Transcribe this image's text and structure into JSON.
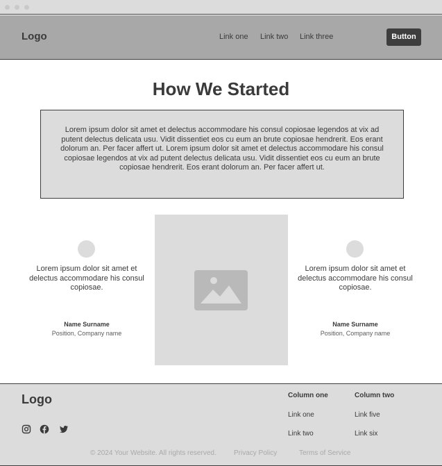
{
  "header": {
    "logo": "Logo",
    "nav": [
      "Link one",
      "Link two",
      "Link three"
    ],
    "button": "Button"
  },
  "hero": {
    "title": "How We Started",
    "body": "Lorem ipsum dolor sit amet et delectus accommodare his consul copiosae legendos at vix ad putent delectus delicata usu. Vidit dissentiet eos cu eum an brute copiosae hendrerit. Eos erant dolorum an. Per facer affert ut. Lorem ipsum dolor sit amet et delectus accommodare his consul copiosae legendos at vix ad putent delectus delicata usu. Vidit dissentiet eos cu eum an brute copiosae hendrerit. Eos erant dolorum an. Per facer affert ut."
  },
  "testimonials": [
    {
      "quote": "Lorem ipsum dolor sit amet et delectus accommodare his consul copiosae.",
      "name": "Name Surname",
      "position": "Position, Company name"
    },
    {
      "quote": "Lorem ipsum dolor sit amet et delectus accommodare his consul copiosae.",
      "name": "Name Surname",
      "position": "Position, Company name"
    }
  ],
  "media": {
    "icon": "image-placeholder-icon"
  },
  "footer": {
    "logo": "Logo",
    "social_icons": [
      "instagram-icon",
      "facebook-icon",
      "twitter-icon"
    ],
    "columns": [
      {
        "heading": "Column one",
        "links": [
          "Link one",
          "Link two"
        ]
      },
      {
        "heading": "Column two",
        "links": [
          "Link five",
          "Link six"
        ]
      }
    ],
    "copyright": "© 2024 Your Website. All rights reserved.",
    "privacy": "Privacy Policy",
    "terms": "Terms of Service"
  },
  "colors": {
    "header_bg": "#a8a8a8",
    "panel_bg": "#dcdcdc",
    "button_bg": "#3e3e3e",
    "text": "#3a3a3a"
  }
}
